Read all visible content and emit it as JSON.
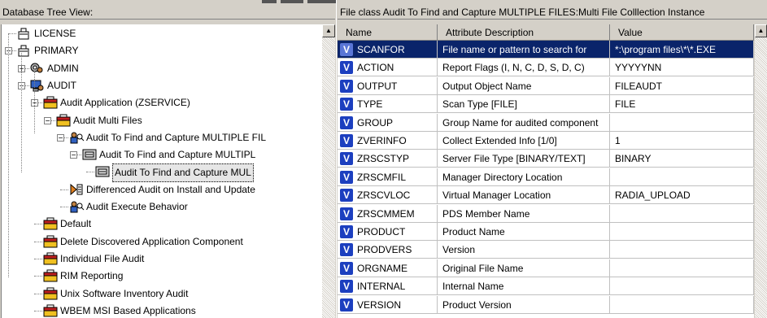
{
  "left_pane": {
    "header": "Database Tree View:",
    "tree": [
      {
        "label": "LICENSE",
        "icon": "briefcase-icon",
        "expander": ""
      },
      {
        "label": "PRIMARY",
        "icon": "briefcase-icon",
        "expander": "−"
      },
      {
        "label": "ADMIN",
        "icon": "gear-people-icon",
        "expander": "+"
      },
      {
        "label": "AUDIT",
        "icon": "monitor-people-icon",
        "expander": "−"
      },
      {
        "label": "Audit Application (ZSERVICE)",
        "icon": "app-box-icon",
        "expander": "−"
      },
      {
        "label": "Audit Multi Files",
        "icon": "app-box-icon",
        "expander": "−"
      },
      {
        "label": "Audit To Find and Capture MULTIPLE FIL",
        "icon": "people-find-icon",
        "expander": "−"
      },
      {
        "label": "Audit To Find and Capture MULTIPL",
        "icon": "disk-icon",
        "expander": "−"
      },
      {
        "label": "Audit To Find and Capture MUL",
        "icon": "disk-icon",
        "expander": ""
      },
      {
        "label": "Differenced Audit on Install and Update",
        "icon": "diff-audit-icon",
        "expander": ""
      },
      {
        "label": "Audit Execute Behavior",
        "icon": "people-find-icon",
        "expander": ""
      },
      {
        "label": "Default",
        "icon": "app-box-icon",
        "expander": ""
      },
      {
        "label": "Delete Discovered Application Component",
        "icon": "app-box-icon",
        "expander": ""
      },
      {
        "label": "Individual File Audit",
        "icon": "app-box-icon",
        "expander": ""
      },
      {
        "label": "RIM Reporting",
        "icon": "app-box-icon",
        "expander": ""
      },
      {
        "label": "Unix Software Inventory Audit",
        "icon": "app-box-icon",
        "expander": ""
      },
      {
        "label": "WBEM MSI Based Applications",
        "icon": "app-box-icon",
        "expander": ""
      }
    ]
  },
  "right_pane": {
    "header": "File class Audit To Find and Capture MULTIPLE FILES:Multi File Colllection Instance",
    "columns": [
      "Name",
      "Attribute Description",
      "Value"
    ],
    "rows": [
      {
        "badge": "V",
        "name": "SCANFOR",
        "desc": "File name or pattern to search for",
        "value": "*:\\program files\\*\\*.EXE"
      },
      {
        "badge": "V",
        "name": "ACTION",
        "desc": "Report Flags (I, N, C, D, S, D, C)",
        "value": "YYYYYNN"
      },
      {
        "badge": "V",
        "name": "OUTPUT",
        "desc": "Output Object Name",
        "value": "FILEAUDT"
      },
      {
        "badge": "V",
        "name": "TYPE",
        "desc": "Scan Type [FILE]",
        "value": "FILE"
      },
      {
        "badge": "V",
        "name": "GROUP",
        "desc": "Group Name for audited component",
        "value": ""
      },
      {
        "badge": "V",
        "name": "ZVERINFO",
        "desc": "Collect Extended Info [1/0]",
        "value": "1"
      },
      {
        "badge": "V",
        "name": "ZRSCSTYP",
        "desc": "Server File Type [BINARY/TEXT]",
        "value": "BINARY"
      },
      {
        "badge": "V",
        "name": "ZRSCMFIL",
        "desc": "Manager Directory Location",
        "value": ""
      },
      {
        "badge": "V",
        "name": "ZRSCVLOC",
        "desc": "Virtual Manager Location",
        "value": "RADIA_UPLOAD"
      },
      {
        "badge": "V",
        "name": "ZRSCMMEM",
        "desc": "PDS Member Name",
        "value": ""
      },
      {
        "badge": "V",
        "name": "PRODUCT",
        "desc": "Product Name",
        "value": ""
      },
      {
        "badge": "V",
        "name": "PRODVERS",
        "desc": "Version",
        "value": ""
      },
      {
        "badge": "V",
        "name": "ORGNAME",
        "desc": "Original File Name",
        "value": ""
      },
      {
        "badge": "V",
        "name": "INTERNAL",
        "desc": "Internal Name",
        "value": ""
      },
      {
        "badge": "V",
        "name": "VERSION",
        "desc": "Product Version",
        "value": ""
      }
    ]
  },
  "colors": {
    "selection": "#0a246a",
    "badge": "#1c3fbf",
    "chrome": "#d4d0c8"
  }
}
